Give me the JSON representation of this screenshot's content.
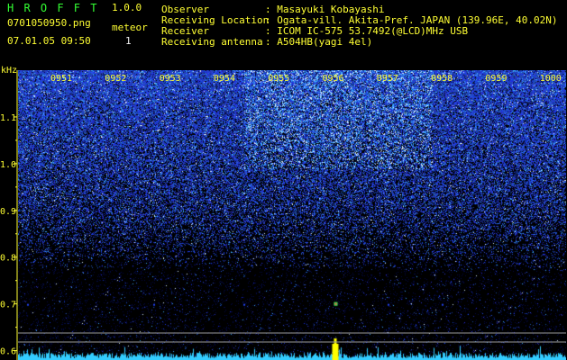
{
  "app": {
    "title": "H R O F F T",
    "version": "1.0.0"
  },
  "file": {
    "name": "0701050950.png",
    "datetime": "07.01.05 09:50"
  },
  "counter": {
    "label": "meteor",
    "value": "1"
  },
  "info": {
    "labels": [
      "Observer",
      "Receiving Location",
      "Receiver",
      "Receiving antenna"
    ],
    "values": [
      ": Masayuki Kobayashi",
      ": Ogata-vill. Akita-Pref. JAPAN (139.96E, 40.02N)",
      ": ICOM IC-575 53.7492(@LCD)MHz USB",
      ": A504HB(yagi 4el)"
    ]
  },
  "colors": {
    "background": "#000000",
    "title_green": "#33ff33",
    "label_yellow": "#ffff33",
    "text_white": "#f2f2f2",
    "signal_blue": "#2a3cff",
    "noise_cyan": "#33ccff",
    "event_yellow": "#ffff00"
  },
  "chart_data": {
    "type": "heatmap",
    "ylabel": "kHz",
    "y_ticks": [
      "1.1",
      "1.0",
      "0.9",
      "0.8",
      "0.7",
      "0.6"
    ],
    "time_labels": [
      "0951",
      "0952",
      "0953",
      "0954",
      "0955",
      "0956",
      "0957",
      "0958",
      "0959",
      "1000"
    ],
    "ylim": [
      0.58,
      1.2
    ],
    "event": {
      "time": "0956",
      "frequency_khz": 0.7
    }
  }
}
